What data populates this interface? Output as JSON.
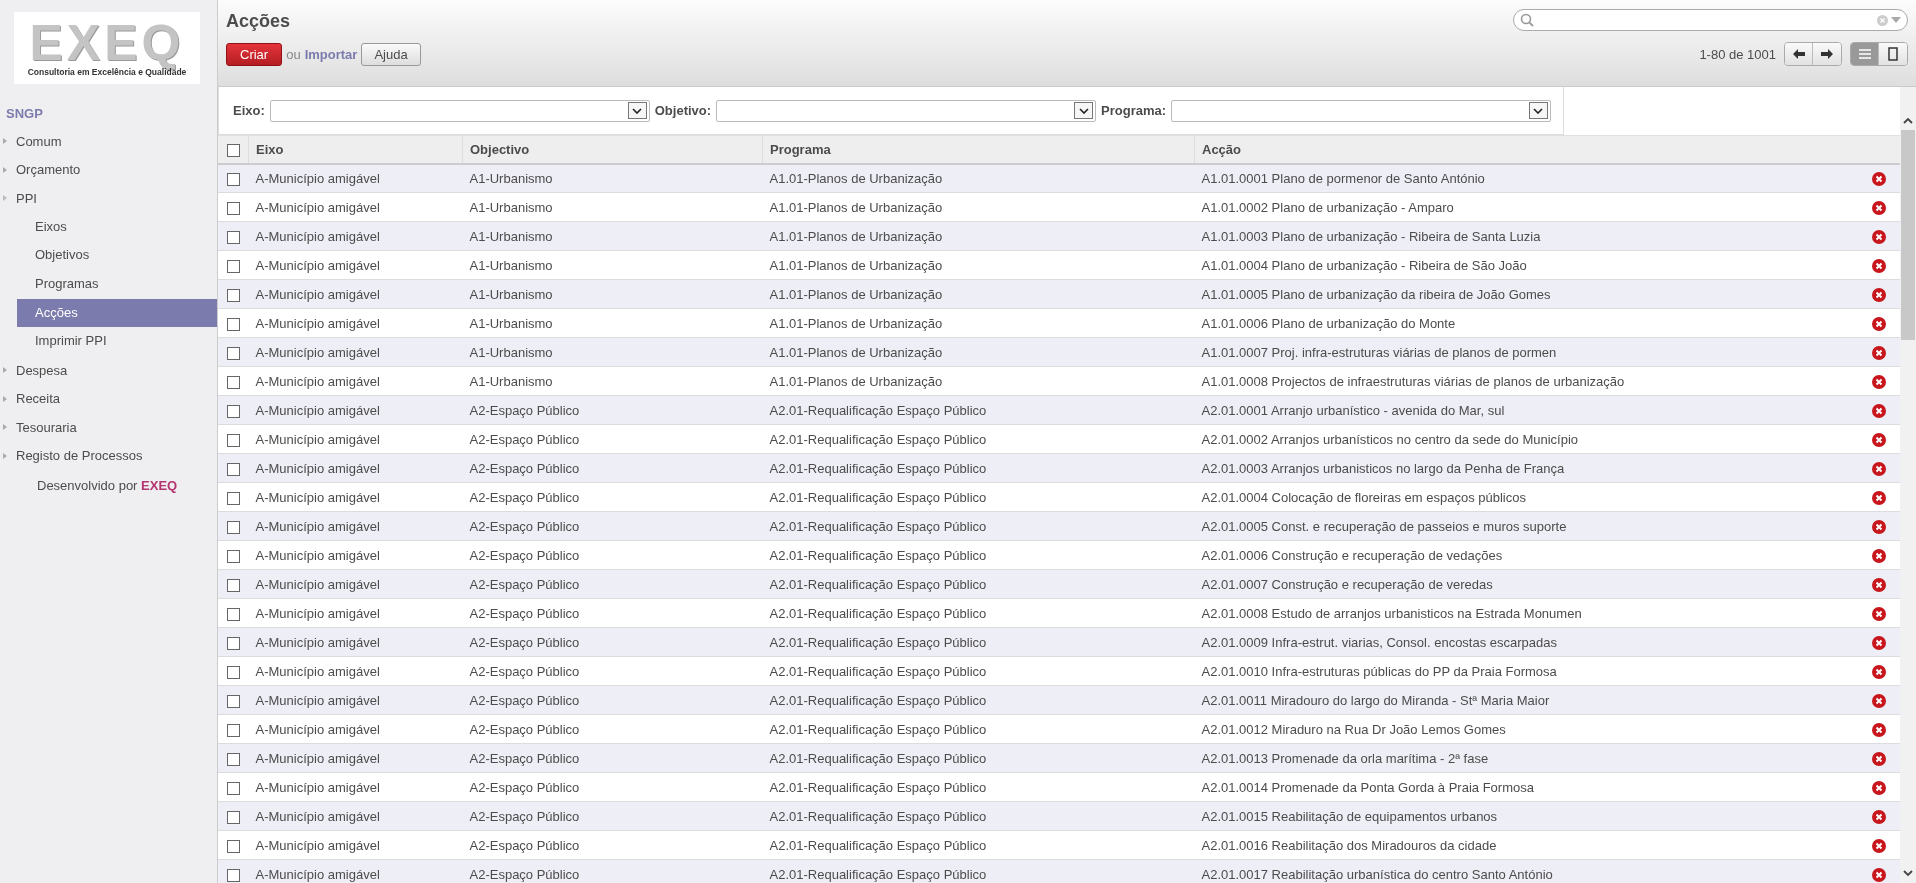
{
  "logo": {
    "name": "EXEQ",
    "tagline": "Consultoria em Excelência e Qualidade"
  },
  "sidebar": {
    "app": "SNGP",
    "items": [
      {
        "label": "Comum",
        "expanded": false
      },
      {
        "label": "Orçamento",
        "expanded": false
      },
      {
        "label": "PPI",
        "expanded": true,
        "children": [
          {
            "label": "Eixos",
            "selected": false
          },
          {
            "label": "Objetivos",
            "selected": false
          },
          {
            "label": "Programas",
            "selected": false
          },
          {
            "label": "Acções",
            "selected": true
          },
          {
            "label": "Imprimir PPI",
            "selected": false
          }
        ]
      },
      {
        "label": "Despesa",
        "expanded": false
      },
      {
        "label": "Receita",
        "expanded": false
      },
      {
        "label": "Tesouraria",
        "expanded": false
      },
      {
        "label": "Registo de Processos",
        "expanded": false
      }
    ],
    "footer": {
      "text": "Desenvolvido por",
      "brand": "EXEQ"
    }
  },
  "page": {
    "title": "Acções",
    "create": "Criar",
    "or": "ou",
    "import": "Importar",
    "help": "Ajuda",
    "pager": "1-80 de 1001"
  },
  "filters": [
    {
      "label": "Eixo:"
    },
    {
      "label": "Objetivo:"
    },
    {
      "label": "Programa:"
    }
  ],
  "table": {
    "all_checked": false,
    "columns": [
      "Eixo",
      "Objectivo",
      "Programa",
      "Acção"
    ],
    "rows": [
      {
        "checked": false,
        "cells": [
          "A-Município amigável",
          "A1-Urbanismo",
          "A1.01-Planos de Urbanização",
          "A1.01.0001 Plano de pormenor de Santo António"
        ]
      },
      {
        "checked": false,
        "cells": [
          "A-Município amigável",
          "A1-Urbanismo",
          "A1.01-Planos de Urbanização",
          "A1.01.0002 Plano de urbanização - Amparo"
        ]
      },
      {
        "checked": false,
        "cells": [
          "A-Município amigável",
          "A1-Urbanismo",
          "A1.01-Planos de Urbanização",
          "A1.01.0003 Plano de urbanização - Ribeira de Santa Luzia"
        ]
      },
      {
        "checked": false,
        "cells": [
          "A-Município amigável",
          "A1-Urbanismo",
          "A1.01-Planos de Urbanização",
          "A1.01.0004 Plano de urbanização - Ribeira de São João"
        ]
      },
      {
        "checked": false,
        "cells": [
          "A-Município amigável",
          "A1-Urbanismo",
          "A1.01-Planos de Urbanização",
          "A1.01.0005 Plano de urbanização da ribeira de João Gomes"
        ]
      },
      {
        "checked": false,
        "cells": [
          "A-Município amigável",
          "A1-Urbanismo",
          "A1.01-Planos de Urbanização",
          "A1.01.0006 Plano de urbanização do Monte"
        ]
      },
      {
        "checked": false,
        "cells": [
          "A-Município amigável",
          "A1-Urbanismo",
          "A1.01-Planos de Urbanização",
          "A1.01.0007 Proj. infra-estruturas viárias de planos de pormen"
        ]
      },
      {
        "checked": false,
        "cells": [
          "A-Município amigável",
          "A1-Urbanismo",
          "A1.01-Planos de Urbanização",
          "A1.01.0008 Projectos de infraestruturas viárias de planos de urbanização"
        ]
      },
      {
        "checked": false,
        "cells": [
          "A-Município amigável",
          "A2-Espaço Público",
          "A2.01-Requalificação Espaço Público",
          "A2.01.0001 Arranjo urbanístico - avenida do Mar, sul"
        ]
      },
      {
        "checked": false,
        "cells": [
          "A-Município amigável",
          "A2-Espaço Público",
          "A2.01-Requalificação Espaço Público",
          "A2.01.0002 Arranjos urbanísticos no centro da sede do Município"
        ]
      },
      {
        "checked": false,
        "cells": [
          "A-Município amigável",
          "A2-Espaço Público",
          "A2.01-Requalificação Espaço Público",
          "A2.01.0003 Arranjos urbanisticos no largo da Penha de França"
        ]
      },
      {
        "checked": false,
        "cells": [
          "A-Município amigável",
          "A2-Espaço Público",
          "A2.01-Requalificação Espaço Público",
          "A2.01.0004 Colocação de floreiras em espaços públicos"
        ]
      },
      {
        "checked": false,
        "cells": [
          "A-Município amigável",
          "A2-Espaço Público",
          "A2.01-Requalificação Espaço Público",
          "A2.01.0005 Const. e recuperação de passeios e muros suporte"
        ]
      },
      {
        "checked": false,
        "cells": [
          "A-Município amigável",
          "A2-Espaço Público",
          "A2.01-Requalificação Espaço Público",
          "A2.01.0006 Construção e recuperação de vedações"
        ]
      },
      {
        "checked": false,
        "cells": [
          "A-Município amigável",
          "A2-Espaço Público",
          "A2.01-Requalificação Espaço Público",
          "A2.01.0007 Construção e recuperação de veredas"
        ]
      },
      {
        "checked": false,
        "cells": [
          "A-Município amigável",
          "A2-Espaço Público",
          "A2.01-Requalificação Espaço Público",
          "A2.01.0008 Estudo de arranjos urbanisticos na Estrada Monumen"
        ]
      },
      {
        "checked": false,
        "cells": [
          "A-Município amigável",
          "A2-Espaço Público",
          "A2.01-Requalificação Espaço Público",
          "A2.01.0009 Infra-estrut. viarias, Consol. encostas escarpadas"
        ]
      },
      {
        "checked": false,
        "cells": [
          "A-Município amigável",
          "A2-Espaço Público",
          "A2.01-Requalificação Espaço Público",
          "A2.01.0010 Infra-estruturas públicas do PP da Praia Formosa"
        ]
      },
      {
        "checked": false,
        "cells": [
          "A-Município amigável",
          "A2-Espaço Público",
          "A2.01-Requalificação Espaço Público",
          "A2.01.0011 Miradouro do largo do Miranda - Stª Maria Maior"
        ]
      },
      {
        "checked": false,
        "cells": [
          "A-Município amigável",
          "A2-Espaço Público",
          "A2.01-Requalificação Espaço Público",
          "A2.01.0012 Miraduro na Rua Dr João Lemos Gomes"
        ]
      },
      {
        "checked": false,
        "cells": [
          "A-Município amigável",
          "A2-Espaço Público",
          "A2.01-Requalificação Espaço Público",
          "A2.01.0013 Promenade da orla marítima - 2ª fase"
        ]
      },
      {
        "checked": false,
        "cells": [
          "A-Município amigável",
          "A2-Espaço Público",
          "A2.01-Requalificação Espaço Público",
          "A2.01.0014 Promenade da Ponta Gorda à Praia Formosa"
        ]
      },
      {
        "checked": false,
        "cells": [
          "A-Município amigável",
          "A2-Espaço Público",
          "A2.01-Requalificação Espaço Público",
          "A2.01.0015 Reabilitação de equipamentos urbanos"
        ]
      },
      {
        "checked": false,
        "cells": [
          "A-Município amigável",
          "A2-Espaço Público",
          "A2.01-Requalificação Espaço Público",
          "A2.01.0016 Reabilitação dos Miradouros da cidade"
        ]
      },
      {
        "checked": false,
        "cells": [
          "A-Município amigável",
          "A2-Espaço Público",
          "A2.01-Requalificação Espaço Público",
          "A2.01.0017 Reabilitação urbanística do centro Santo António"
        ]
      }
    ]
  }
}
